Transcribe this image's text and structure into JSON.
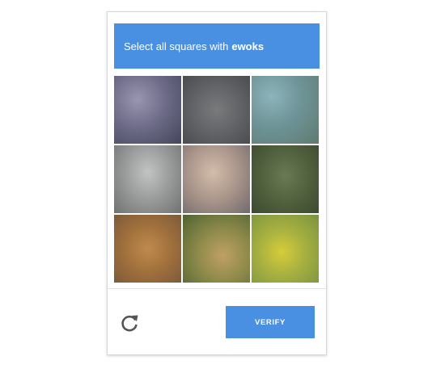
{
  "challenge": {
    "instruction": "Select all squares with",
    "keyword": "ewoks",
    "header_color": "#4a90e2"
  },
  "tiles": [
    {
      "id": "tile-1",
      "gradient": "radial-gradient(ellipse at 35% 35%, #9896b0 0%, #6e6c88 45%, #44465c 100%)"
    },
    {
      "id": "tile-2",
      "gradient": "radial-gradient(ellipse at 50% 50%, #787a7c 0%, #5f6164 55%, #4a4c4f 100%)"
    },
    {
      "id": "tile-3",
      "gradient": "radial-gradient(ellipse at 30% 30%, #8db4bb 0%, #6e9498 45%, #5f7a6e 100%)"
    },
    {
      "id": "tile-4",
      "gradient": "radial-gradient(ellipse at 50% 40%, #c2c4c4 0%, #989a9a 50%, #707272 100%)"
    },
    {
      "id": "tile-5",
      "gradient": "radial-gradient(ellipse at 45% 40%, #d3bcaa 0%, #a8948a 50%, #6f6a6c 100%)"
    },
    {
      "id": "tile-6",
      "gradient": "radial-gradient(ellipse at 50% 45%, #6a7a52 0%, #4f5e3c 55%, #3c4a30 100%)"
    },
    {
      "id": "tile-7",
      "gradient": "radial-gradient(ellipse at 50% 50%, #c08a4e 0%, #a0703c 50%, #7d5a3a 100%)"
    },
    {
      "id": "tile-8",
      "gradient": "radial-gradient(ellipse at 60% 60%, #c0a064 0%, #8e8a4a 45%, #4e6232 100%)"
    },
    {
      "id": "tile-9",
      "gradient": "radial-gradient(ellipse at 45% 55%, #d7cc3a 0%, #a6b040 45%, #7a9240 100%)"
    }
  ],
  "actions": {
    "reload_icon": "reload-icon",
    "verify_label": "VERIFY",
    "verify_color": "#4a90e2"
  }
}
